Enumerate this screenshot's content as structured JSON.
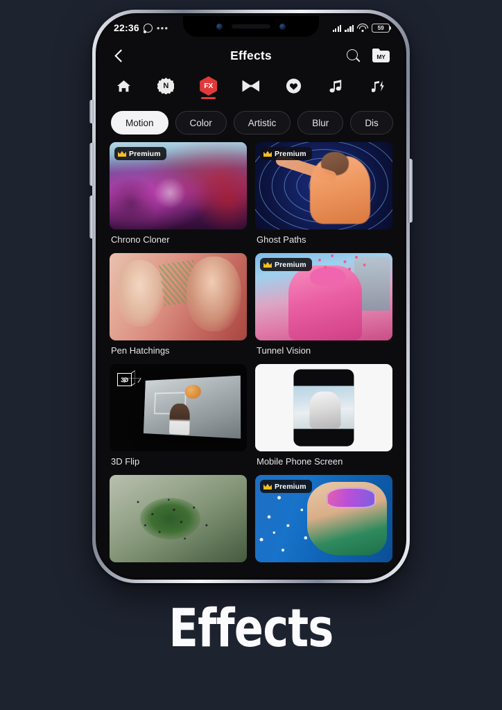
{
  "status_bar": {
    "time": "22:36",
    "whatsapp_icon": "whatsapp-icon",
    "more_icon": "•••",
    "battery_percent": "59"
  },
  "app_bar": {
    "back_icon": "back-arrow-icon",
    "title": "Effects",
    "search_icon": "search-icon",
    "my_folder_label": "MY"
  },
  "categories": [
    {
      "icon": "home-icon",
      "glyph": "⌂",
      "active": false
    },
    {
      "icon": "new-badge-icon",
      "glyph": "N",
      "active": false
    },
    {
      "icon": "fx-icon",
      "glyph": "FX",
      "active": true
    },
    {
      "icon": "transition-icon",
      "glyph": "",
      "active": false
    },
    {
      "icon": "heart-icon",
      "glyph": "",
      "active": false
    },
    {
      "icon": "music-icon",
      "glyph": "♫",
      "active": false
    },
    {
      "icon": "sound-fx-icon",
      "glyph": "♪",
      "active": false
    }
  ],
  "filter_chips": [
    {
      "label": "Motion",
      "active": true
    },
    {
      "label": "Color",
      "active": false
    },
    {
      "label": "Artistic",
      "active": false
    },
    {
      "label": "Blur",
      "active": false
    },
    {
      "label": "Dis",
      "active": false
    }
  ],
  "premium_badge_label": "Premium",
  "effects": [
    {
      "name": "Chrono Cloner",
      "premium": true,
      "art": "art-chrono"
    },
    {
      "name": "Ghost Paths",
      "premium": true,
      "art": "art-ghost"
    },
    {
      "name": "Pen Hatchings",
      "premium": false,
      "art": "art-pen"
    },
    {
      "name": "Tunnel Vision",
      "premium": true,
      "art": "art-tunnel"
    },
    {
      "name": "3D Flip",
      "premium": false,
      "art": "art-3d"
    },
    {
      "name": "Mobile Phone Screen",
      "premium": false,
      "art": "art-mobile"
    },
    {
      "name": "",
      "premium": false,
      "art": "art-disp"
    },
    {
      "name": "",
      "premium": true,
      "art": "art-water"
    }
  ],
  "caption": "Effects",
  "colors": {
    "page_background": "#1e2330",
    "screen_background": "#0c0c0e",
    "accent_red": "#e03a3a",
    "chip_active_bg": "#f3f3f5",
    "premium_gold": "#f3bd28"
  }
}
